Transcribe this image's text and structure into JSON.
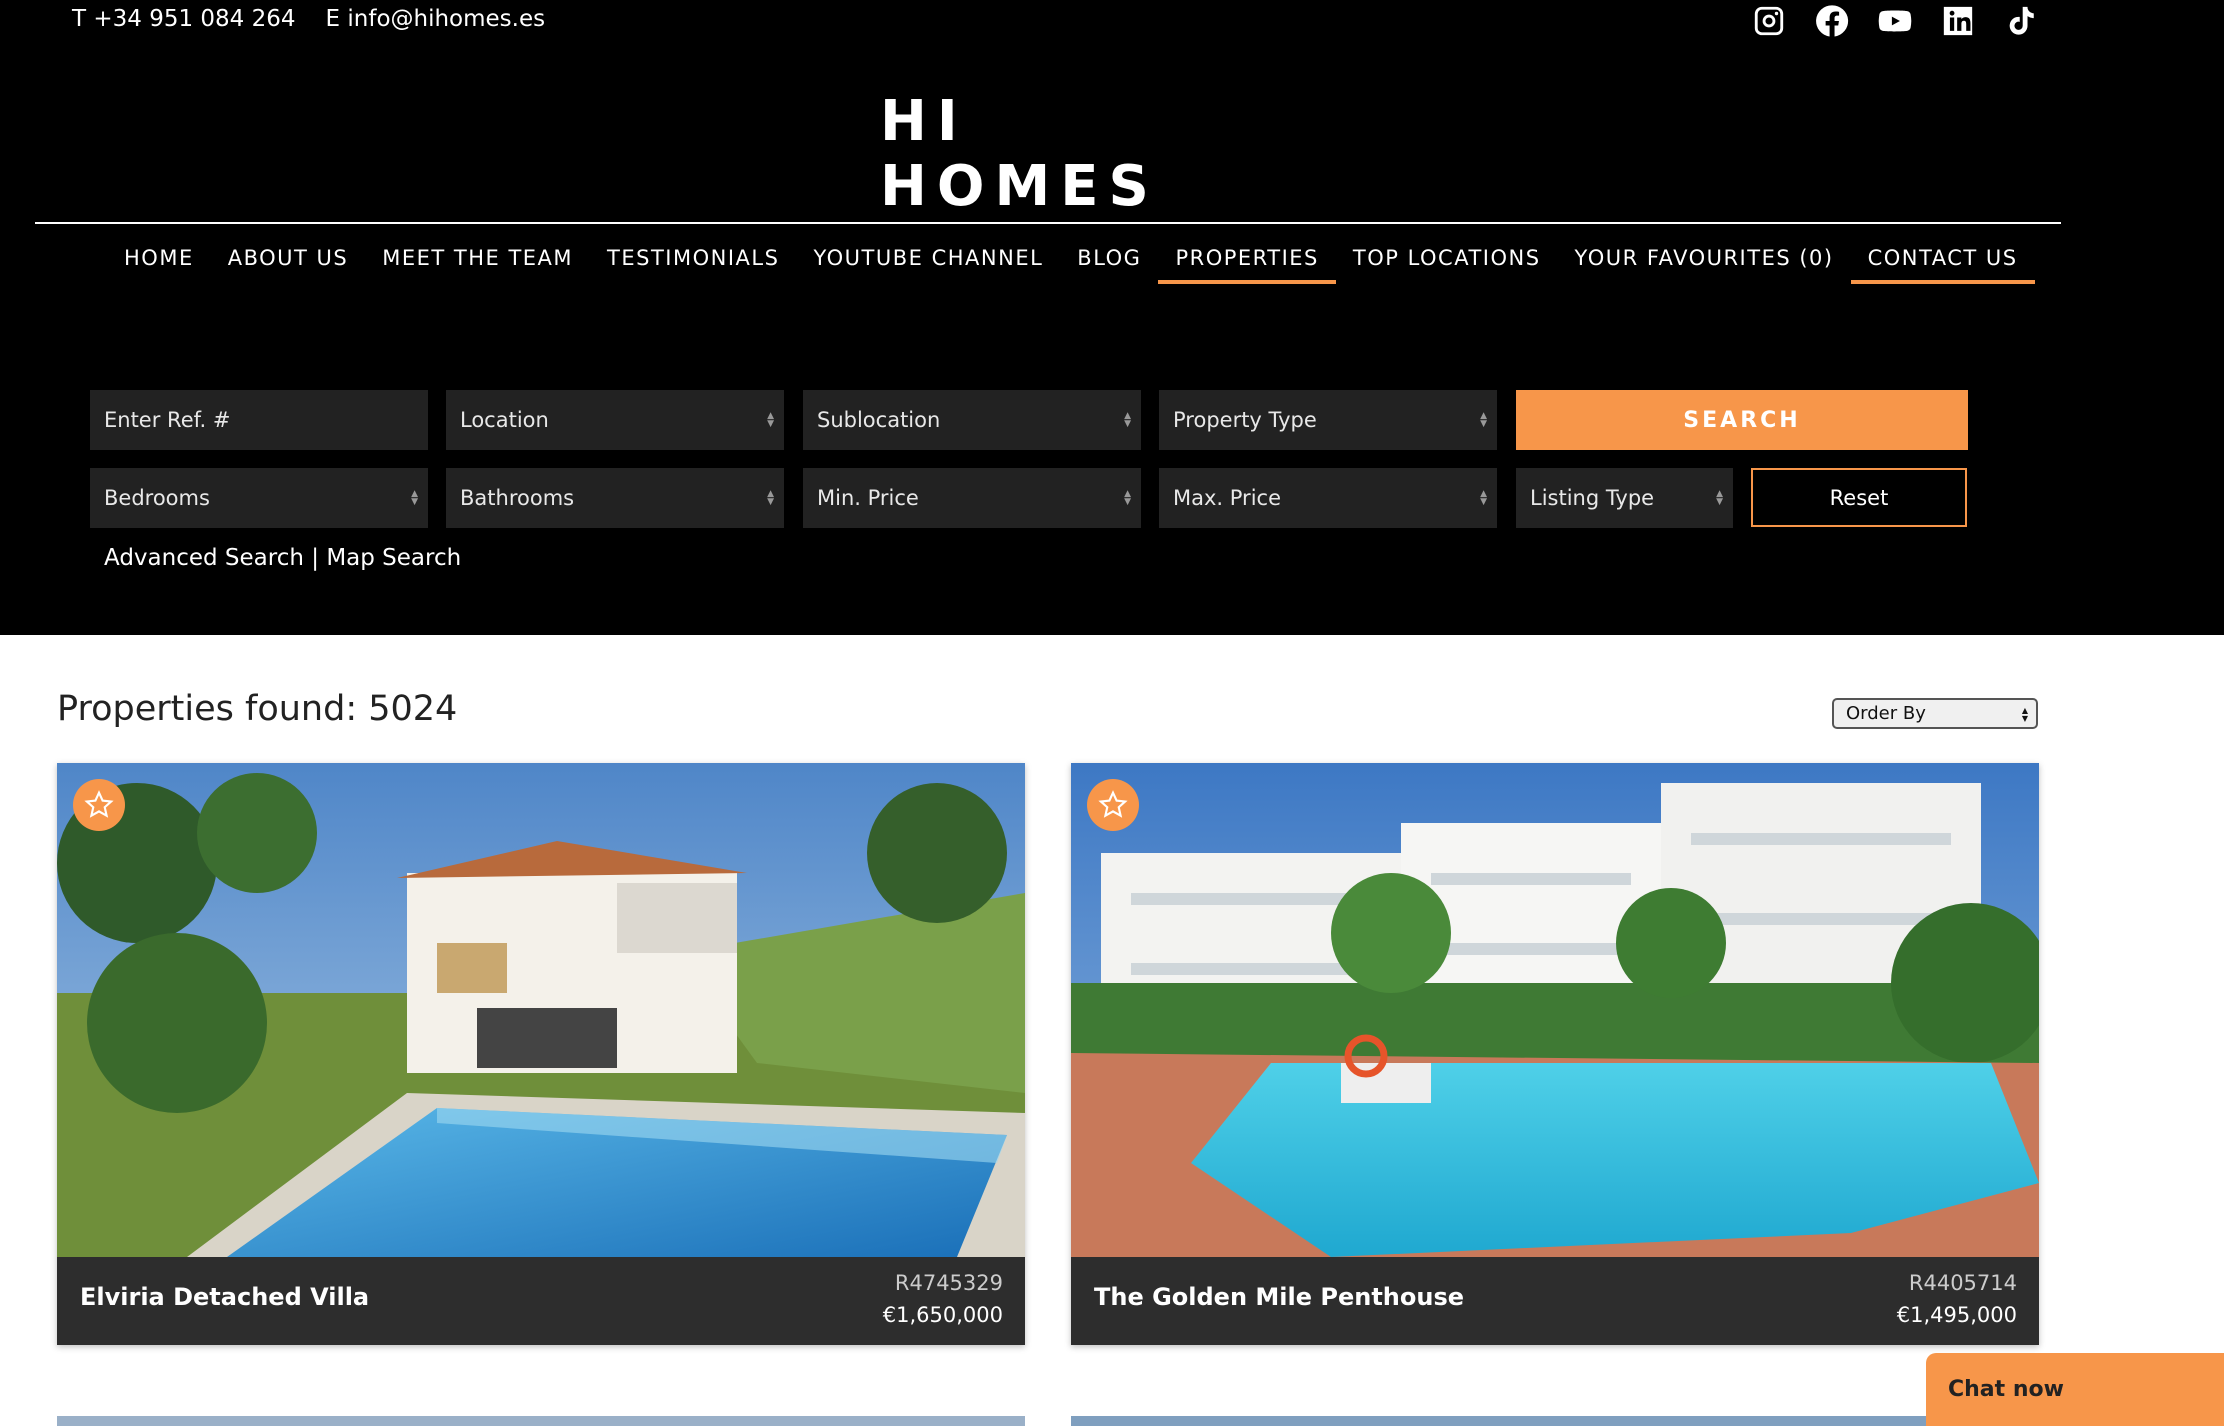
{
  "topbar": {
    "phone": "T +34 951 084 264",
    "email": "E info@hihomes.es",
    "social": [
      "instagram-icon",
      "facebook-icon",
      "youtube-icon",
      "linkedin-icon",
      "tiktok-icon"
    ]
  },
  "logo": {
    "text": "HI HOMES"
  },
  "nav": {
    "items": [
      {
        "label": "HOME"
      },
      {
        "label": "ABOUT US"
      },
      {
        "label": "MEET THE TEAM"
      },
      {
        "label": "TESTIMONIALS"
      },
      {
        "label": "YOUTUBE CHANNEL"
      },
      {
        "label": "BLOG"
      },
      {
        "label": "PROPERTIES",
        "active": true
      },
      {
        "label": "TOP LOCATIONS"
      },
      {
        "label": "YOUR FAVOURITES (0)"
      },
      {
        "label": "CONTACT US",
        "active": true
      }
    ]
  },
  "search": {
    "ref_placeholder": "Enter Ref. #",
    "location": "Location",
    "sublocation": "Sublocation",
    "property_type": "Property Type",
    "search_label": "SEARCH",
    "bedrooms": "Bedrooms",
    "bathrooms": "Bathrooms",
    "min_price": "Min. Price",
    "max_price": "Max. Price",
    "listing_type": "Listing Type",
    "reset_label": "Reset",
    "advanced_link": "Advanced Search",
    "separator": " | ",
    "map_link": "Map Search"
  },
  "results": {
    "found_label": "Properties found: 5024",
    "order_by": "Order By"
  },
  "properties": [
    {
      "title": "Elviria Detached Villa",
      "ref": "R4745329",
      "price": "€1,650,000"
    },
    {
      "title": "The Golden Mile Penthouse",
      "ref": "R4405714",
      "price": "€1,495,000"
    }
  ],
  "chat": {
    "label": "Chat now"
  },
  "colors": {
    "accent": "#f7964a",
    "header_bg": "#000000",
    "field_bg": "#222222",
    "card_info_bg": "#2d2d2d"
  }
}
